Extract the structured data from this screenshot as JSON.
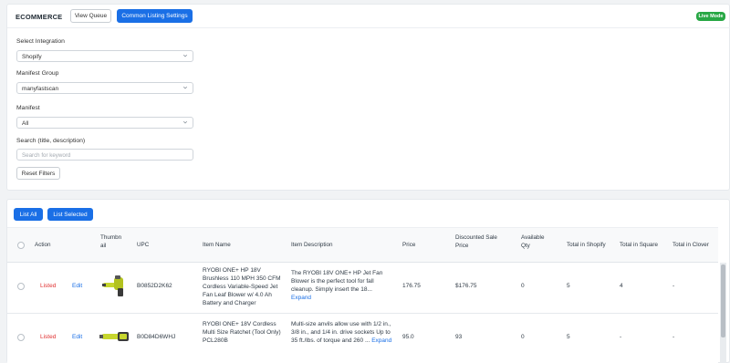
{
  "header": {
    "brand": "ECOMMERCE",
    "view_queue": "View Queue",
    "common_settings": "Common Listing Settings",
    "mode_badge": "Live Mode"
  },
  "filters": {
    "integration_label": "Select Integration",
    "integration_value": "Shopify",
    "manifest_group_label": "Manifest Group",
    "manifest_group_value": "manyfastscan",
    "manifest_label": "Manifest",
    "manifest_value": "All",
    "search_label": "Search (title, description)",
    "search_placeholder": "Search for keyword",
    "reset_label": "Reset Filters"
  },
  "actions": {
    "list_all": "List All",
    "list_selected": "List Selected"
  },
  "table": {
    "headers": {
      "action": "Action",
      "thumbnail": "Thumbn ail",
      "upc": "UPC",
      "item_name": "Item Name",
      "item_description": "Item Description",
      "price": "Price",
      "discounted": "Discounted Sale Price",
      "available": "Available Qty",
      "total_shopify": "Total in Shopify",
      "total_square": "Total in Square",
      "total_clover": "Total in Clover"
    },
    "rows": [
      {
        "status": "Listed",
        "edit": "Edit",
        "upc": "B0852D2K62",
        "name": "RYOBI ONE+ HP 18V Brushless 110 MPH 350 CFM Cordless Variable-Speed Jet Fan Leaf Blower w/ 4.0 Ah Battery and Charger",
        "description": "The RYOBI 18V ONE+ HP Jet Fan Blower is the perfect tool for fall cleanup. Simply insert the 18...",
        "expand": "Expand",
        "price": "176.75",
        "discounted": "$176.75",
        "available": "0",
        "total_shopify": "5",
        "total_square": "4",
        "total_clover": "-"
      },
      {
        "status": "Listed",
        "edit": "Edit",
        "upc": "B0D84D6WHJ",
        "name": "RYOBI ONE+ 18V Cordless Multi Size Ratchet (Tool Only) PCL280B",
        "description": "Multi-size anvils allow use with 1/2 in., 3/8 in., and 1/4 in. drive sockets Up to 35 ft./lbs. of torque and 260 ...",
        "expand": "Expand",
        "price": "95.0",
        "discounted": "93",
        "available": "0",
        "total_shopify": "5",
        "total_square": "-",
        "total_clover": "-"
      }
    ]
  },
  "colors": {
    "primary": "#1a6fe6",
    "listed": "#e03131",
    "live": "#28a745"
  }
}
